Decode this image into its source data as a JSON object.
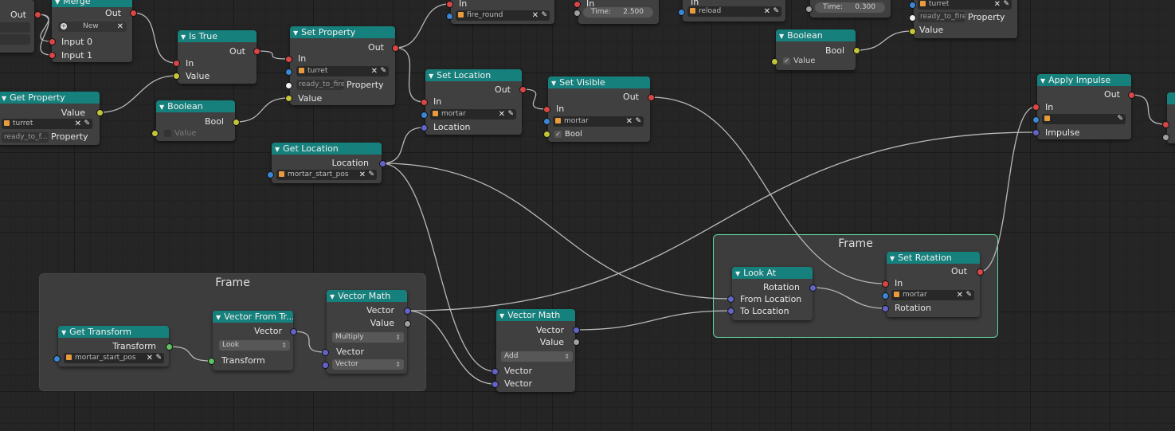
{
  "frames": [
    {
      "title": "Frame"
    },
    {
      "title": "Frame"
    }
  ],
  "nodes": {
    "merge": {
      "title": "Merge",
      "out": "Out",
      "new_label": "New",
      "input0": "Input 0",
      "input1": "Input 1"
    },
    "partial_left": {
      "out": "Out"
    },
    "is_true": {
      "title": "Is True",
      "out": "Out",
      "in": "In",
      "value": "Value"
    },
    "get_property": {
      "title": "Get Property",
      "value": "Value",
      "object": "turret",
      "prop_value": "ready_to_f...",
      "prop_label": "Property"
    },
    "boolean_a": {
      "title": "Boolean",
      "bool": "Bool",
      "value": "Value"
    },
    "set_property_a": {
      "title": "Set Property",
      "out": "Out",
      "in": "In",
      "object": "turret",
      "prop_value": "ready_to_fire",
      "prop_label": "Property",
      "value": "Value"
    },
    "top_play": {
      "in": "In",
      "object": "fire_round"
    },
    "top_timer_a": {
      "in": "In",
      "time_label": "Time:",
      "time_value": "2.500"
    },
    "top_play2": {
      "in": "In",
      "object": "reload"
    },
    "top_timer_b": {
      "time_label": "Time:",
      "time_value": "0.300"
    },
    "set_property_b": {
      "object": "turret",
      "prop_value": "ready_to_fire",
      "prop_label": "Property",
      "value": "Value"
    },
    "boolean_b": {
      "title": "Boolean",
      "bool": "Bool",
      "value": "Value"
    },
    "set_location": {
      "title": "Set Location",
      "out": "Out",
      "in": "In",
      "object": "mortar",
      "location": "Location"
    },
    "set_visible": {
      "title": "Set Visible",
      "out": "Out",
      "in": "In",
      "object": "mortar",
      "bool": "Bool"
    },
    "get_location": {
      "title": "Get Location",
      "location": "Location",
      "object": "mortar_start_pos"
    },
    "apply_impulse": {
      "title": "Apply Impulse",
      "out": "Out",
      "in": "In",
      "impulse": "Impulse"
    },
    "get_transform": {
      "title": "Get Transform",
      "transform": "Transform",
      "object": "mortar_start_pos"
    },
    "vector_from_tr": {
      "title": "Vector From Tr...",
      "vector": "Vector",
      "mode": "Look",
      "transform": "Transform"
    },
    "vector_math_a": {
      "title": "Vector Math",
      "vector": "Vector",
      "value": "Value",
      "op": "Multiply",
      "in_vector": "Vector",
      "in_vector2": "Vector"
    },
    "vector_math_b": {
      "title": "Vector Math",
      "vector": "Vector",
      "value": "Value",
      "op": "Add",
      "in_vector": "Vector",
      "in_vector2": "Vector"
    },
    "look_at": {
      "title": "Look At",
      "rotation": "Rotation",
      "from": "From Location",
      "to": "To Location"
    },
    "set_rotation": {
      "title": "Set Rotation",
      "out": "Out",
      "in": "In",
      "object": "mortar",
      "rotation": "Rotation"
    }
  },
  "colors": {
    "header": "#16807c",
    "node_body": "#404040",
    "frame_selected_border": "#5ed49a",
    "socket_exec": "#d94646",
    "socket_object": "#3b87d6",
    "socket_vector": "#6363c7",
    "socket_bool": "#c4c43a",
    "socket_transform": "#5fc160",
    "socket_float": "#a1a1a1"
  },
  "icons": [
    "collapse-arrow-icon",
    "object-cube-icon",
    "clear-x-icon",
    "eyedropper-icon",
    "checkbox-icon",
    "plus-icon",
    "dropdown-icon"
  ]
}
